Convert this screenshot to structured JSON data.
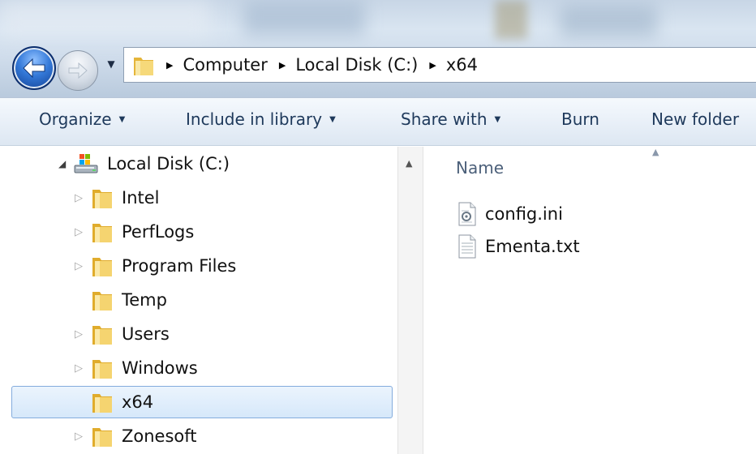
{
  "address": {
    "crumbs": [
      "Computer",
      "Local Disk (C:)",
      "x64"
    ]
  },
  "toolbar": {
    "organize": "Organize",
    "include_in_library": "Include in library",
    "share_with": "Share with",
    "burn": "Burn",
    "new_folder": "New folder"
  },
  "nav_tree": {
    "root": "Local Disk (C:)",
    "items": [
      {
        "label": "Intel",
        "has_children": true
      },
      {
        "label": "PerfLogs",
        "has_children": true
      },
      {
        "label": "Program Files",
        "has_children": true
      },
      {
        "label": "Temp",
        "has_children": false
      },
      {
        "label": "Users",
        "has_children": true
      },
      {
        "label": "Windows",
        "has_children": true
      },
      {
        "label": "x64",
        "has_children": false,
        "selected": true
      },
      {
        "label": "Zonesoft",
        "has_children": true
      }
    ]
  },
  "content": {
    "column_name": "Name",
    "files": [
      {
        "name": "config.ini",
        "icon": "settings-file-icon"
      },
      {
        "name": "Ementa.txt",
        "icon": "text-file-icon"
      }
    ]
  },
  "colors": {
    "toolbar_text": "#1e395b",
    "selection_border": "#84acdd",
    "selection_fill": "#d6e8fa",
    "folder_yellow": "#f2c94c"
  }
}
